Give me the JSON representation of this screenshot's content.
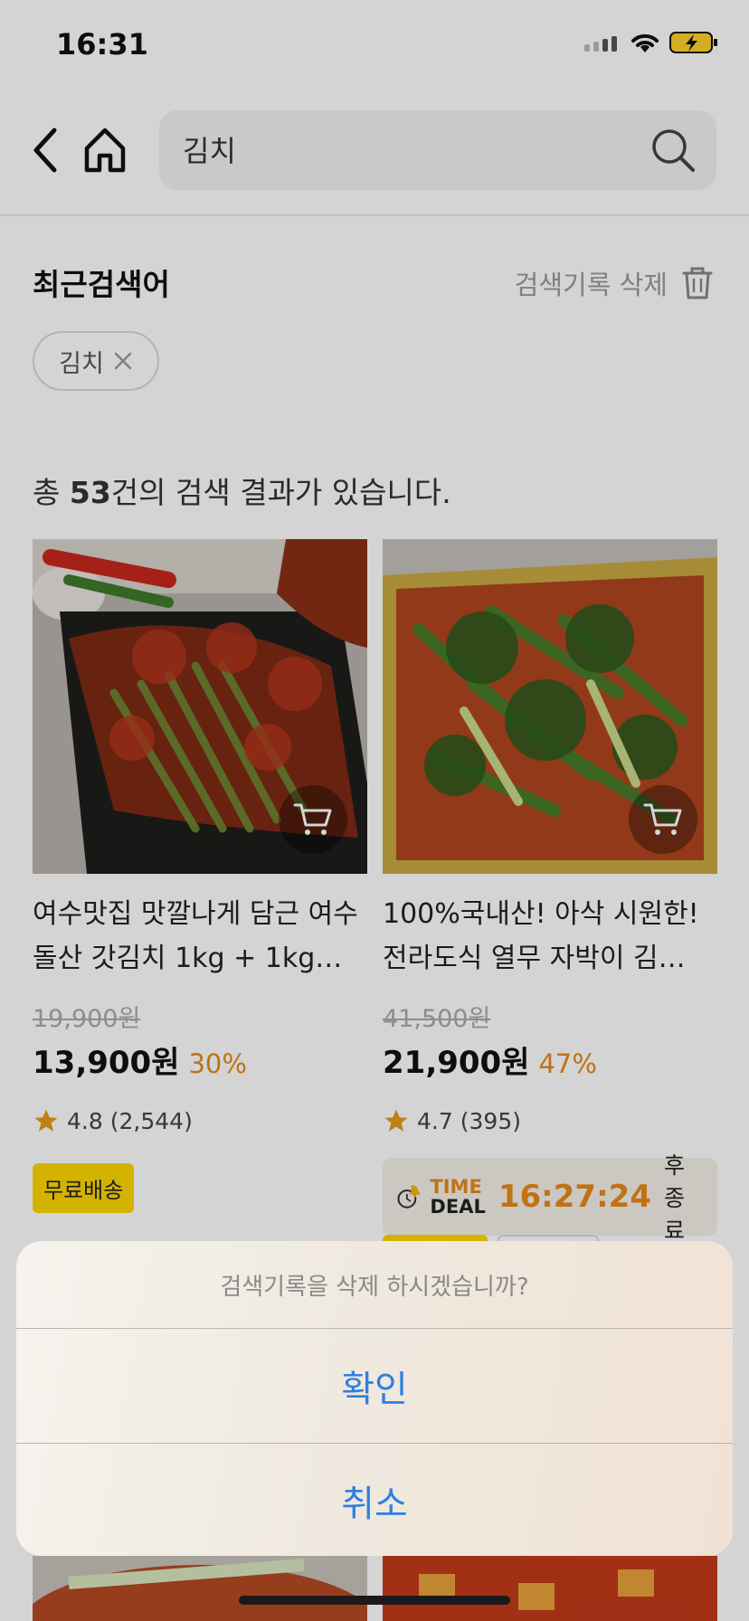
{
  "status_bar": {
    "time": "16:31"
  },
  "search": {
    "value": "김치"
  },
  "recent": {
    "title": "최근검색어",
    "delete_label": "검색기록 삭제",
    "chips": [
      "김치"
    ]
  },
  "results": {
    "prefix": "총 ",
    "count": "53",
    "suffix": "건의 검색 결과가 있습니다."
  },
  "products": [
    {
      "title": "여수맛집 맛깔나게 담근 여수 돌산 갓김치 1kg + 1kg…",
      "original_price": "19,900원",
      "price": "13,900원",
      "discount": "30%",
      "rating": "4.8",
      "reviews": "(2,544)",
      "badge": "무료배송"
    },
    {
      "title": "100%국내산! 아삭 시원한! 전라도식 열무 자박이 김…",
      "original_price": "41,500원",
      "price": "21,900원",
      "discount": "47%",
      "rating": "4.7",
      "reviews": "(395)",
      "timedeal": {
        "label_top": "TIME",
        "label_bottom": "DEAL",
        "time": "16:27:24",
        "suffix": "후 종료"
      }
    }
  ],
  "dialog": {
    "message": "검색기록을 삭제 하시겠습니까?",
    "confirm": "확인",
    "cancel": "취소"
  },
  "colors": {
    "accent_orange": "#e78a1a",
    "badge_yellow": "#ffd600",
    "ios_blue": "#2f7fe0"
  }
}
